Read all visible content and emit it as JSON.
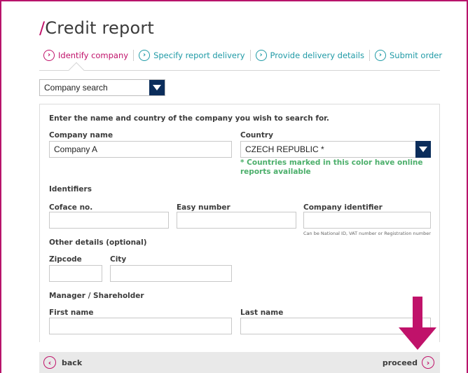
{
  "page": {
    "title_slash": "/",
    "title": "Credit report"
  },
  "steps": [
    {
      "label": "Identify company",
      "icon": "chevron-right-circle-icon",
      "active": true
    },
    {
      "label": "Specify report delivery",
      "icon": "chevron-right-circle-icon",
      "active": false
    },
    {
      "label": "Provide delivery details",
      "icon": "chevron-right-circle-icon",
      "active": false
    },
    {
      "label": "Submit order",
      "icon": "chevron-right-circle-icon",
      "active": false
    }
  ],
  "search_type": {
    "selected": "Company search"
  },
  "form": {
    "intro": "Enter the name and country of the company you wish to search for.",
    "company_name_label": "Company name",
    "company_name_value": "Company A",
    "country_label": "Country",
    "country_value": "CZECH REPUBLIC *",
    "country_note": "* Countries marked in this color have online reports available",
    "identifiers_heading": "Identifiers",
    "coface_label": "Coface no.",
    "coface_value": "",
    "easy_number_label": "Easy number",
    "easy_number_value": "",
    "company_identifier_label": "Company identifier",
    "company_identifier_value": "",
    "company_identifier_hint": "Can be National ID, VAT number or Registration number",
    "other_details_heading": "Other details (optional)",
    "zipcode_label": "Zipcode",
    "zipcode_value": "",
    "city_label": "City",
    "city_value": "",
    "manager_heading": "Manager / Shareholder",
    "first_name_label": "First name",
    "first_name_value": "",
    "last_name_label": "Last name",
    "last_name_value": ""
  },
  "footer": {
    "back_label": "back",
    "proceed_label": "proceed"
  },
  "colors": {
    "accent": "#c0126a",
    "teal": "#1f9aa6",
    "navy": "#0b2d5b",
    "note_green": "#4caf6b"
  }
}
